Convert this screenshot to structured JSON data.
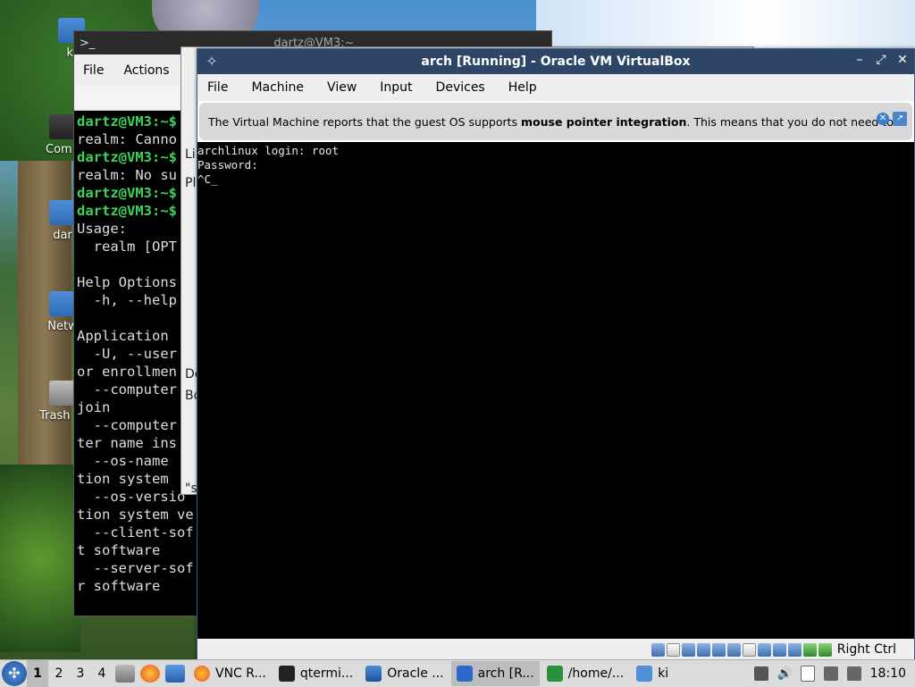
{
  "desktop": {
    "icons": [
      {
        "label": "ki"
      },
      {
        "label": "Comp"
      },
      {
        "label": "dar"
      },
      {
        "label": "Netw"
      },
      {
        "label": "Trash (E"
      }
    ]
  },
  "terminal_bg": {
    "title": "dartz@VM3:~",
    "menu": [
      "File",
      "Actions"
    ],
    "lines": [
      {
        "prompt": "dartz@VM3:~$",
        "text": ""
      },
      {
        "prompt": "",
        "text": "realm: Canno"
      },
      {
        "prompt": "dartz@VM3:~$",
        "text": ""
      },
      {
        "prompt": "",
        "text": "realm: No su"
      },
      {
        "prompt": "dartz@VM3:~$",
        "text": ""
      },
      {
        "prompt": "dartz@VM3:~$",
        "text": ""
      },
      {
        "prompt": "",
        "text": "Usage:"
      },
      {
        "prompt": "",
        "text": "  realm [OPT"
      },
      {
        "prompt": "",
        "text": ""
      },
      {
        "prompt": "",
        "text": "Help Options"
      },
      {
        "prompt": "",
        "text": "  -h, --help"
      },
      {
        "prompt": "",
        "text": ""
      },
      {
        "prompt": "",
        "text": "Application"
      },
      {
        "prompt": "",
        "text": "  -U, --user"
      },
      {
        "prompt": "",
        "text": "or enrollmen"
      },
      {
        "prompt": "",
        "text": "  --computer"
      },
      {
        "prompt": "",
        "text": "join"
      },
      {
        "prompt": "",
        "text": "  --computer"
      },
      {
        "prompt": "",
        "text": "ter name ins"
      },
      {
        "prompt": "",
        "text": "  --os-name"
      },
      {
        "prompt": "",
        "text": "tion system"
      },
      {
        "prompt": "",
        "text": "  --os-versio"
      },
      {
        "prompt": "",
        "text": "tion system ve"
      },
      {
        "prompt": "",
        "text": "  --client-sof"
      },
      {
        "prompt": "",
        "text": "t software"
      },
      {
        "prompt": "",
        "text": "  --server-sof"
      },
      {
        "prompt": "",
        "text": "r software"
      }
    ]
  },
  "mid_window": {
    "fragments": [
      "Li",
      "Pl",
      "De",
      "Bo",
      "\"s"
    ]
  },
  "vbox": {
    "title": "arch [Running] - Oracle VM VirtualBox",
    "menu": [
      "File",
      "Machine",
      "View",
      "Input",
      "Devices",
      "Help"
    ],
    "notice_pre": "The Virtual Machine reports that the guest OS supports ",
    "notice_bold": "mouse pointer integration",
    "notice_post": ". This means that you do not need to",
    "console_lines": [
      "archlinux login: root",
      "Password:",
      "^C_"
    ],
    "host_key": "Right Ctrl"
  },
  "taskbar": {
    "workspaces": [
      "1",
      "2",
      "3",
      "4"
    ],
    "tasks": [
      {
        "label": "VNC R...",
        "icon": "firefox-icon"
      },
      {
        "label": "qtermi...",
        "icon": "terminal-icon"
      },
      {
        "label": "Oracle ...",
        "icon": "virtualbox-icon"
      },
      {
        "label": "arch [R...",
        "icon": "arch-icon"
      },
      {
        "label": "/home/...",
        "icon": "folder-icon"
      },
      {
        "label": "ki",
        "icon": "folder-icon"
      }
    ],
    "clock": "18:10"
  }
}
